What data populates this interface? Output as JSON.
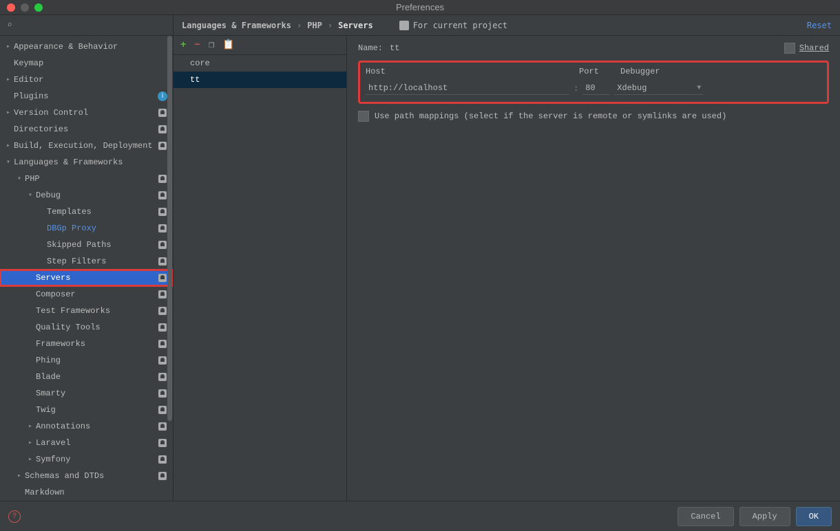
{
  "window": {
    "title": "Preferences"
  },
  "sidebar": {
    "items": [
      {
        "label": "Appearance & Behavior",
        "indent": 1,
        "chev": "right",
        "badge": ""
      },
      {
        "label": "Keymap",
        "indent": 1,
        "chev": "",
        "badge": ""
      },
      {
        "label": "Editor",
        "indent": 1,
        "chev": "right",
        "badge": ""
      },
      {
        "label": "Plugins",
        "indent": 1,
        "chev": "",
        "badge": "info"
      },
      {
        "label": "Version Control",
        "indent": 1,
        "chev": "right",
        "badge": "person"
      },
      {
        "label": "Directories",
        "indent": 1,
        "chev": "",
        "badge": "person"
      },
      {
        "label": "Build, Execution, Deployment",
        "indent": 1,
        "chev": "right",
        "badge": "person"
      },
      {
        "label": "Languages & Frameworks",
        "indent": 1,
        "chev": "down",
        "badge": ""
      },
      {
        "label": "PHP",
        "indent": 2,
        "chev": "down",
        "badge": "person"
      },
      {
        "label": "Debug",
        "indent": 3,
        "chev": "down",
        "badge": "person"
      },
      {
        "label": "Templates",
        "indent": 4,
        "chev": "",
        "badge": "person"
      },
      {
        "label": "DBGp Proxy",
        "indent": 4,
        "chev": "",
        "badge": "person",
        "link": true
      },
      {
        "label": "Skipped Paths",
        "indent": 4,
        "chev": "",
        "badge": "person"
      },
      {
        "label": "Step Filters",
        "indent": 4,
        "chev": "",
        "badge": "person"
      },
      {
        "label": "Servers",
        "indent": 3,
        "chev": "",
        "badge": "person",
        "selected": true,
        "red": true
      },
      {
        "label": "Composer",
        "indent": 3,
        "chev": "",
        "badge": "person"
      },
      {
        "label": "Test Frameworks",
        "indent": 3,
        "chev": "",
        "badge": "person"
      },
      {
        "label": "Quality Tools",
        "indent": 3,
        "chev": "",
        "badge": "person"
      },
      {
        "label": "Frameworks",
        "indent": 3,
        "chev": "",
        "badge": "person"
      },
      {
        "label": "Phing",
        "indent": 3,
        "chev": "",
        "badge": "person"
      },
      {
        "label": "Blade",
        "indent": 3,
        "chev": "",
        "badge": "person"
      },
      {
        "label": "Smarty",
        "indent": 3,
        "chev": "",
        "badge": "person"
      },
      {
        "label": "Twig",
        "indent": 3,
        "chev": "",
        "badge": "person"
      },
      {
        "label": "Annotations",
        "indent": 3,
        "chev": "right",
        "badge": "person"
      },
      {
        "label": "Laravel",
        "indent": 3,
        "chev": "right",
        "badge": "person"
      },
      {
        "label": "Symfony",
        "indent": 3,
        "chev": "right",
        "badge": "person"
      },
      {
        "label": "Schemas and DTDs",
        "indent": 2,
        "chev": "right",
        "badge": "person"
      },
      {
        "label": "Markdown",
        "indent": 2,
        "chev": "",
        "badge": ""
      }
    ]
  },
  "breadcrumb": {
    "a": "Languages & Frameworks",
    "b": "PHP",
    "c": "Servers",
    "project": "For current project",
    "reset": "Reset"
  },
  "servers": {
    "items": [
      {
        "name": "core"
      },
      {
        "name": "tt",
        "selected": true
      }
    ]
  },
  "detail": {
    "name_label": "Name:",
    "name_value": "tt",
    "shared_label": "Shared",
    "host_label": "Host",
    "port_label": "Port",
    "debugger_label": "Debugger",
    "host_value": "http://localhost",
    "port_value": "80",
    "debugger_value": "Xdebug",
    "path_mappings": "Use path mappings (select if the server is remote or symlinks are used)"
  },
  "footer": {
    "cancel": "Cancel",
    "apply": "Apply",
    "ok": "OK"
  }
}
